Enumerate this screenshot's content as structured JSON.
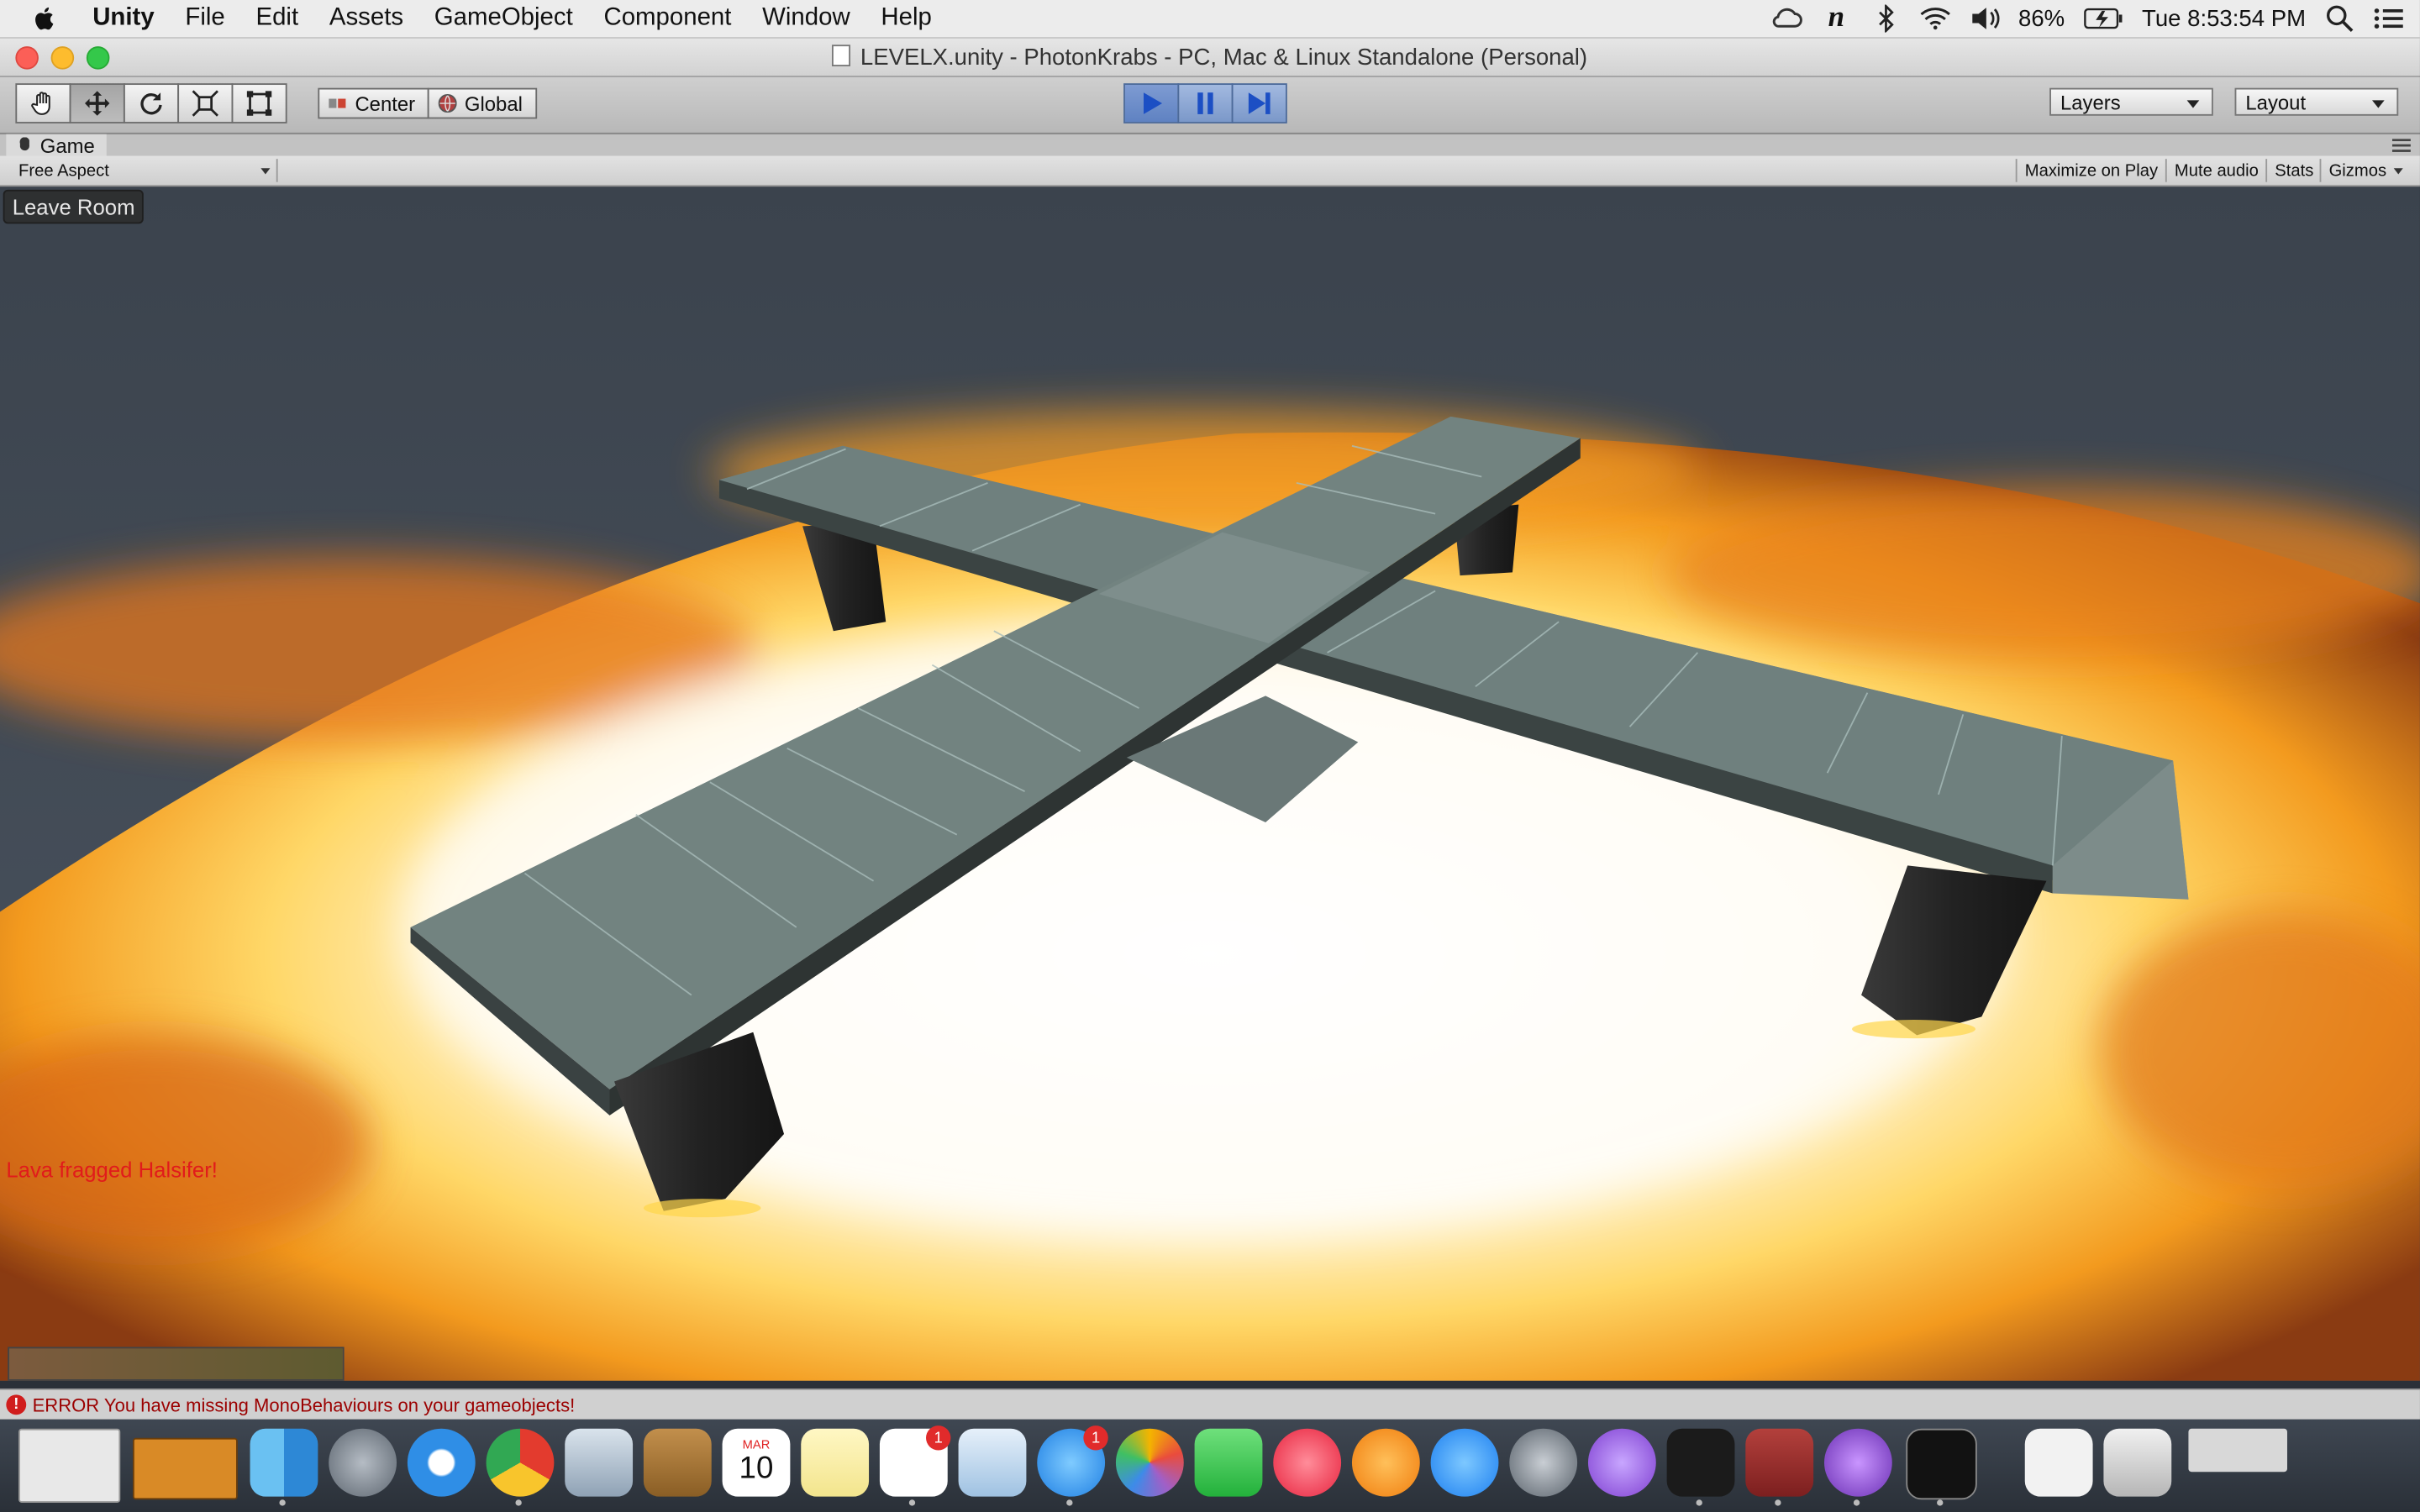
{
  "menubar": {
    "app": "Unity",
    "items": [
      "File",
      "Edit",
      "Assets",
      "GameObject",
      "Component",
      "Window",
      "Help"
    ],
    "battery": "86%",
    "clock": "Tue 8:53:54 PM"
  },
  "window": {
    "title": "LEVELX.unity - PhotonKrabs - PC, Mac & Linux Standalone (Personal)"
  },
  "toolbar": {
    "pivot_center": "Center",
    "pivot_global": "Global",
    "layers": "Layers",
    "layout": "Layout"
  },
  "game_view": {
    "tab_label": "Game",
    "aspect": "Free Aspect",
    "maximize_on_play": "Maximize on Play",
    "mute_audio": "Mute audio",
    "stats": "Stats",
    "gizmos": "Gizmos"
  },
  "hud": {
    "leave_room": "Leave Room",
    "kill_message": "Lava fragged Halsifer!",
    "kill_color": "#e11b1b"
  },
  "console": {
    "error": "ERROR You have missing MonoBehaviours on your gameobjects!"
  },
  "dock": {
    "calendar_month": "MAR",
    "calendar_day": "10",
    "reminders_badge": "1",
    "messages_badge": "1"
  },
  "colors": {
    "play_blue": "#5f82c2",
    "lava_orange": "#f39a1e",
    "platform_gray": "#7f918f"
  }
}
